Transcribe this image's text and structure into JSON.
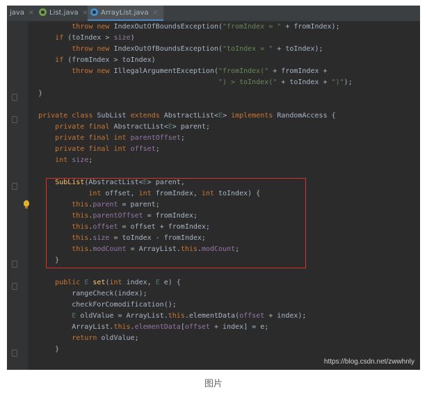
{
  "tabs": [
    {
      "label": "java",
      "active": false
    },
    {
      "label": "List.java",
      "active": false,
      "icon": "interface-icon"
    },
    {
      "label": "ArrayList.java",
      "active": true,
      "icon": "class-icon"
    }
  ],
  "code_lines": [
    "            throw new IndexOutOfBoundsException(\"fromIndex = \" + fromIndex);",
    "        if (toIndex > size)",
    "            throw new IndexOutOfBoundsException(\"toIndex = \" + toIndex);",
    "        if (fromIndex > toIndex)",
    "            throw new IllegalArgumentException(\"fromIndex(\" + fromIndex +",
    "                                               \") > toIndex(\" + toIndex + \")\");",
    "    }",
    "",
    "    private class SubList extends AbstractList<E> implements RandomAccess {",
    "        private final AbstractList<E> parent;",
    "        private final int parentOffset;",
    "        private final int offset;",
    "        int size;",
    "",
    "        SubList(AbstractList<E> parent,",
    "                int offset, int fromIndex, int toIndex) {",
    "            this.parent = parent;",
    "            this.parentOffset = fromIndex;",
    "            this.offset = offset + fromIndex;",
    "            this.size = toIndex - fromIndex;",
    "            this.modCount = ArrayList.this.modCount;",
    "        }",
    "",
    "        public E set(int index, E e) {",
    "            rangeCheck(index);",
    "            checkForComodification();",
    "            E oldValue = ArrayList.this.elementData(offset + index);",
    "            ArrayList.this.elementData[offset + index] = e;",
    "            return oldValue;",
    "        }"
  ],
  "watermark": "https://blog.csdn.net/zwwhnly",
  "caption": "图片",
  "colors": {
    "editor_bg": "#2b2b2b",
    "keyword": "#cc7832",
    "field": "#9876aa",
    "string": "#6a8759",
    "method": "#ffc66d",
    "highlight_border": "#d9342b"
  }
}
